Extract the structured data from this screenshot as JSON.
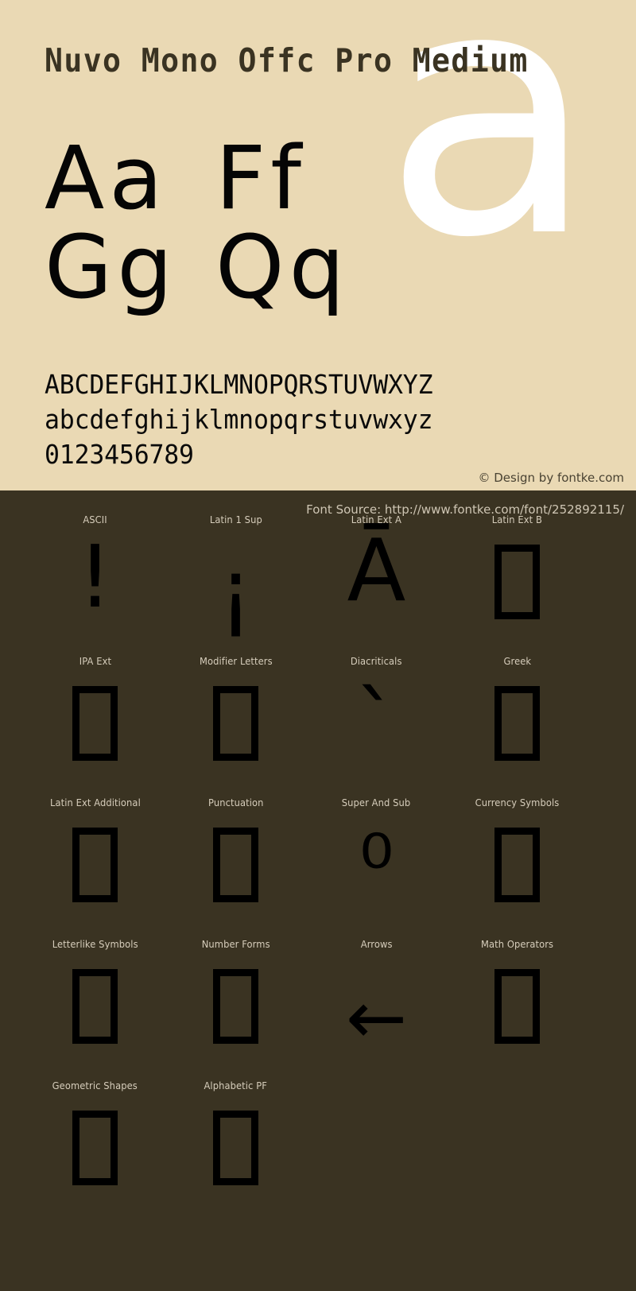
{
  "page": {
    "background_top": "#ead9b4",
    "background_bottom": "#3a3322",
    "text_dark": "#3a3322",
    "text_light": "#d6cdbb",
    "glyph_color": "#000000",
    "watermark_color": "#ffffff"
  },
  "preview": {
    "font_title": "Nuvo Mono Offc Pro Medium",
    "watermark_letter": "a",
    "sample_rows": [
      {
        "left": "Aa",
        "right": "Ff"
      },
      {
        "left": "Gg",
        "right": "Qq"
      }
    ],
    "uppercase": "ABCDEFGHIJKLMNOPQRSTUVWXYZ",
    "lowercase": "abcdefghijklmnopqrstuvwxyz",
    "digits": "0123456789",
    "credit": "© Design by fontke.com"
  },
  "source": {
    "label": "Font Source: http://www.fontke.com/font/252892115/"
  },
  "unicode_blocks": [
    {
      "label": "ASCII",
      "glyph": "!",
      "glyph_kind": "char",
      "glyph_class": "glyph-exclam"
    },
    {
      "label": "Latin 1 Sup",
      "glyph": "¡",
      "glyph_kind": "char",
      "glyph_class": "glyph-invexclam"
    },
    {
      "label": "Latin Ext A",
      "glyph": "Ā",
      "glyph_kind": "char",
      "glyph_class": "glyph-amacron"
    },
    {
      "label": "Latin Ext B",
      "glyph": "",
      "glyph_kind": "tofu",
      "glyph_class": ""
    },
    {
      "label": "IPA Ext",
      "glyph": "",
      "glyph_kind": "tofu",
      "glyph_class": ""
    },
    {
      "label": "Modifier Letters",
      "glyph": "",
      "glyph_kind": "tofu",
      "glyph_class": ""
    },
    {
      "label": "Diacriticals",
      "glyph": "ˋ",
      "glyph_kind": "char",
      "glyph_class": "glyph-grave"
    },
    {
      "label": "Greek",
      "glyph": "",
      "glyph_kind": "tofu",
      "glyph_class": ""
    },
    {
      "label": "Latin Ext Additional",
      "glyph": "",
      "glyph_kind": "tofu",
      "glyph_class": ""
    },
    {
      "label": "Punctuation",
      "glyph": "",
      "glyph_kind": "tofu",
      "glyph_class": ""
    },
    {
      "label": "Super And Sub",
      "glyph": "⁰",
      "glyph_kind": "char",
      "glyph_class": "glyph-supzero"
    },
    {
      "label": "Currency Symbols",
      "glyph": "",
      "glyph_kind": "tofu",
      "glyph_class": ""
    },
    {
      "label": "Letterlike Symbols",
      "glyph": "",
      "glyph_kind": "tofu",
      "glyph_class": ""
    },
    {
      "label": "Number Forms",
      "glyph": "",
      "glyph_kind": "tofu",
      "glyph_class": ""
    },
    {
      "label": "Arrows",
      "glyph": "←",
      "glyph_kind": "char",
      "glyph_class": "glyph-arrow"
    },
    {
      "label": "Math Operators",
      "glyph": "",
      "glyph_kind": "tofu",
      "glyph_class": ""
    },
    {
      "label": "Geometric Shapes",
      "glyph": "",
      "glyph_kind": "tofu",
      "glyph_class": ""
    },
    {
      "label": "Alphabetic PF",
      "glyph": "",
      "glyph_kind": "tofu",
      "glyph_class": ""
    }
  ]
}
